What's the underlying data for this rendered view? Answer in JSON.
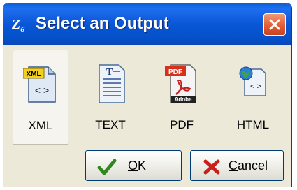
{
  "window": {
    "title": "Select an Output",
    "app_icon": "Z6"
  },
  "choices": [
    {
      "label": "XML",
      "icon": "xml-file-icon",
      "selected": true
    },
    {
      "label": "TEXT",
      "icon": "text-file-icon",
      "selected": false
    },
    {
      "label": "PDF",
      "icon": "pdf-file-icon",
      "selected": false
    },
    {
      "label": "HTML",
      "icon": "html-file-icon",
      "selected": false
    }
  ],
  "buttons": {
    "ok_first": "O",
    "ok_rest": "K",
    "cancel_first": "C",
    "cancel_rest": "ancel"
  },
  "colors": {
    "titlebar": "#0a56d6",
    "close": "#e35d35",
    "dialog_bg": "#ece9d8"
  }
}
